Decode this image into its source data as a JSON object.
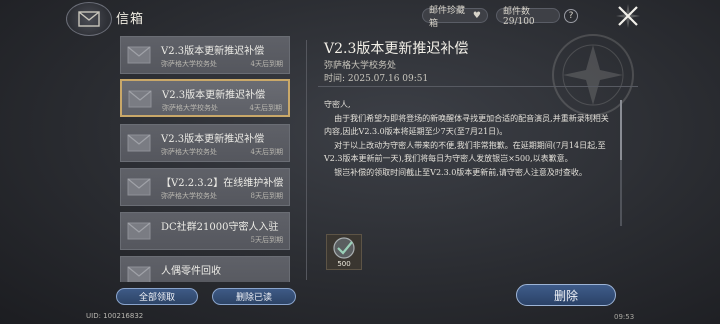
{
  "header": {
    "title": "信箱",
    "collection_label": "邮件珍藏箱",
    "count_label": "邮件数29/100",
    "help_glyph": "?"
  },
  "mail_list": [
    {
      "title": "V2.3版本更新推迟补偿",
      "sender": "弥萨格大学校务处",
      "expiry": "4天后到期",
      "selected": false
    },
    {
      "title": "V2.3版本更新推迟补偿",
      "sender": "弥萨格大学校务处",
      "expiry": "4天后到期",
      "selected": true
    },
    {
      "title": "V2.3版本更新推迟补偿",
      "sender": "弥萨格大学校务处",
      "expiry": "4天后到期",
      "selected": false
    },
    {
      "title": "【V2.2.3.2】在线维护补偿",
      "sender": "弥萨格大学校务处",
      "expiry": "8天后到期",
      "selected": false
    },
    {
      "title": "DC社群21000守密人入驻",
      "sender": "",
      "expiry": "5天后到期",
      "selected": false
    },
    {
      "title": "人偶零件回收",
      "sender": "",
      "expiry": "",
      "selected": false
    }
  ],
  "actions": {
    "claim_all": "全部领取",
    "delete_read": "删除已读",
    "delete": "删除"
  },
  "uid": "UID: 100216832",
  "clock": "09:53",
  "detail": {
    "title": "V2.3版本更新推迟补偿",
    "sender": "弥萨格大学校务处",
    "time": "时间: 2025.07.16 09:51",
    "body": [
      "守密人,",
      "    由于我们希望为即将登场的新唤醒体寻找更加合适的配音演员,并重新录制相关内容,因此V2.3.0版本将延期至少7天(至7月21日)。",
      "    对于以上改动为守密人带来的不便,我们非常抱歉。在延期期间(7月14日起,至V2.3版本更新前一天),我们将每日为守密人发放银岂×500,以表歉意。",
      "    银岂补偿的领取时间截止至V2.3.0版本更新前,请守密人注意及时查收。"
    ],
    "attachment_qty": "500",
    "attachment_icon": "silver-coin-icon"
  },
  "colors": {
    "accent_gold": "#c9a869",
    "button_blue": "#2d4466"
  }
}
